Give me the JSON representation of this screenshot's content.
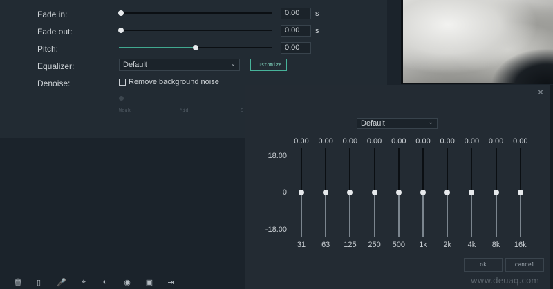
{
  "audio": {
    "fade_in": {
      "label": "Fade in:",
      "value": "0.00",
      "unit": "s",
      "level": 0
    },
    "fade_out": {
      "label": "Fade out:",
      "value": "0.00",
      "unit": "s",
      "level": 0
    },
    "pitch": {
      "label": "Pitch:",
      "value": "0.00",
      "level": 0.5
    },
    "equalizer": {
      "label": "Equalizer:",
      "selected": "Default",
      "customize_label": "Customize"
    },
    "denoise": {
      "label": "Denoise:",
      "checkbox_label": "Remove background noise",
      "checked": false,
      "levels": [
        "Weak",
        "Mid",
        "S"
      ]
    }
  },
  "eq_dialog": {
    "preset": "Default",
    "db_labels": {
      "top": "18.00",
      "mid": "0",
      "bottom": "-18.00"
    },
    "bands": [
      {
        "freq": "31",
        "value": "0.00"
      },
      {
        "freq": "63",
        "value": "0.00"
      },
      {
        "freq": "125",
        "value": "0.00"
      },
      {
        "freq": "250",
        "value": "0.00"
      },
      {
        "freq": "500",
        "value": "0.00"
      },
      {
        "freq": "1k",
        "value": "0.00"
      },
      {
        "freq": "2k",
        "value": "0.00"
      },
      {
        "freq": "4k",
        "value": "0.00"
      },
      {
        "freq": "8k",
        "value": "0.00"
      },
      {
        "freq": "16k",
        "value": "0.00"
      }
    ],
    "ok_label": "ok",
    "cancel_label": "cancel",
    "close_icon": "close-icon"
  },
  "toolbar": {
    "icons": [
      "trash-icon",
      "tag-icon",
      "microphone-icon",
      "crop-icon",
      "speed-icon",
      "color-icon",
      "screen-icon",
      "export-icon"
    ]
  },
  "watermark": "www.deuaq.com",
  "colors": {
    "accent": "#41a88f",
    "panel": "#222b33",
    "background": "#1b232b"
  }
}
